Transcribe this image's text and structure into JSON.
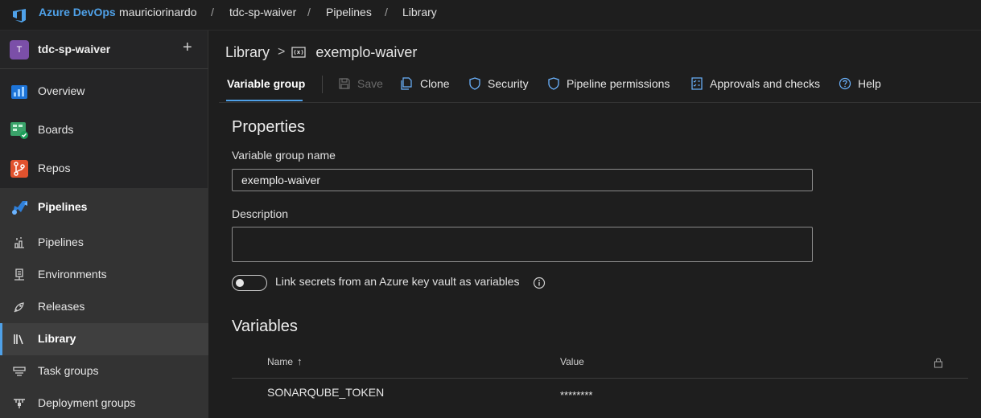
{
  "topbar": {
    "brand": "Azure DevOps",
    "breadcrumbs": [
      "mauriciorinardo",
      "tdc-sp-waiver",
      "Pipelines",
      "Library"
    ],
    "separator": "/"
  },
  "sidebar": {
    "project": {
      "initial": "T",
      "name": "tdc-sp-waiver",
      "add": "+"
    },
    "items": [
      {
        "label": "Overview",
        "icon": "overview-icon"
      },
      {
        "label": "Boards",
        "icon": "boards-icon"
      },
      {
        "label": "Repos",
        "icon": "repos-icon"
      },
      {
        "label": "Pipelines",
        "icon": "pipelines-icon"
      }
    ],
    "sub_items": [
      {
        "label": "Pipelines",
        "icon": "pipelines-sub-icon"
      },
      {
        "label": "Environments",
        "icon": "environments-icon"
      },
      {
        "label": "Releases",
        "icon": "releases-icon"
      },
      {
        "label": "Library",
        "icon": "library-icon",
        "active": true
      },
      {
        "label": "Task groups",
        "icon": "task-groups-icon"
      },
      {
        "label": "Deployment groups",
        "icon": "deployment-groups-icon"
      }
    ]
  },
  "main": {
    "title_root": "Library",
    "title_chevron": ">",
    "title_name": "exemplo-waiver",
    "toolbar": {
      "active_tab": "Variable group",
      "save": "Save",
      "clone": "Clone",
      "security": "Security",
      "pipeline_permissions": "Pipeline permissions",
      "approvals": "Approvals and checks",
      "help": "Help"
    },
    "properties": {
      "heading": "Properties",
      "name_label": "Variable group name",
      "name_value": "exemplo-waiver",
      "description_label": "Description",
      "description_value": "",
      "keyvault_label": "Link secrets from an Azure key vault as variables",
      "keyvault_enabled": false
    },
    "variables": {
      "heading": "Variables",
      "columns": {
        "name": "Name",
        "sort_arrow": "↑",
        "value": "Value"
      },
      "rows": [
        {
          "name": "SONARQUBE_TOKEN",
          "value": "********"
        }
      ]
    }
  },
  "colors": {
    "accent": "#4fa1e8",
    "background": "#1e1e1e",
    "sidebar": "#252526"
  }
}
